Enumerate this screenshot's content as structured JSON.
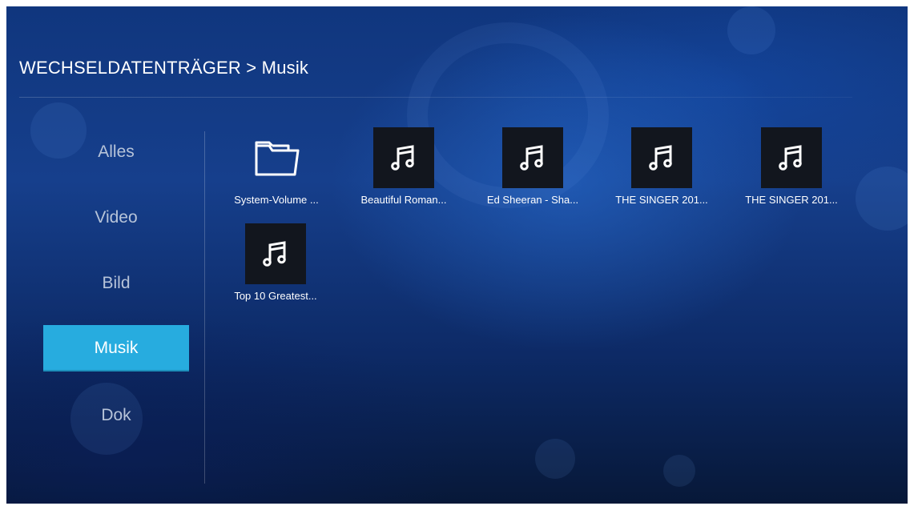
{
  "header": {
    "breadcrumb": "WECHSELDATENTRÄGER > Musik"
  },
  "sidebar": {
    "items": [
      {
        "label": "Alles",
        "active": false
      },
      {
        "label": "Video",
        "active": false
      },
      {
        "label": "Bild",
        "active": false
      },
      {
        "label": "Musik",
        "active": true
      },
      {
        "label": "Dok",
        "active": false
      }
    ]
  },
  "files": [
    {
      "label": "System-Volume ...",
      "icon": "folder-icon"
    },
    {
      "label": "Beautiful Roman...",
      "icon": "music-note-icon"
    },
    {
      "label": "Ed Sheeran - Sha...",
      "icon": "music-note-icon"
    },
    {
      "label": "THE SINGER 201...",
      "icon": "music-note-icon"
    },
    {
      "label": "THE SINGER 201...",
      "icon": "music-note-icon"
    },
    {
      "label": "Top 10 Greatest...",
      "icon": "music-note-icon"
    }
  ],
  "colors": {
    "accent": "#27acdf",
    "background": "#163f8c",
    "thumb_background": "#12161e"
  }
}
